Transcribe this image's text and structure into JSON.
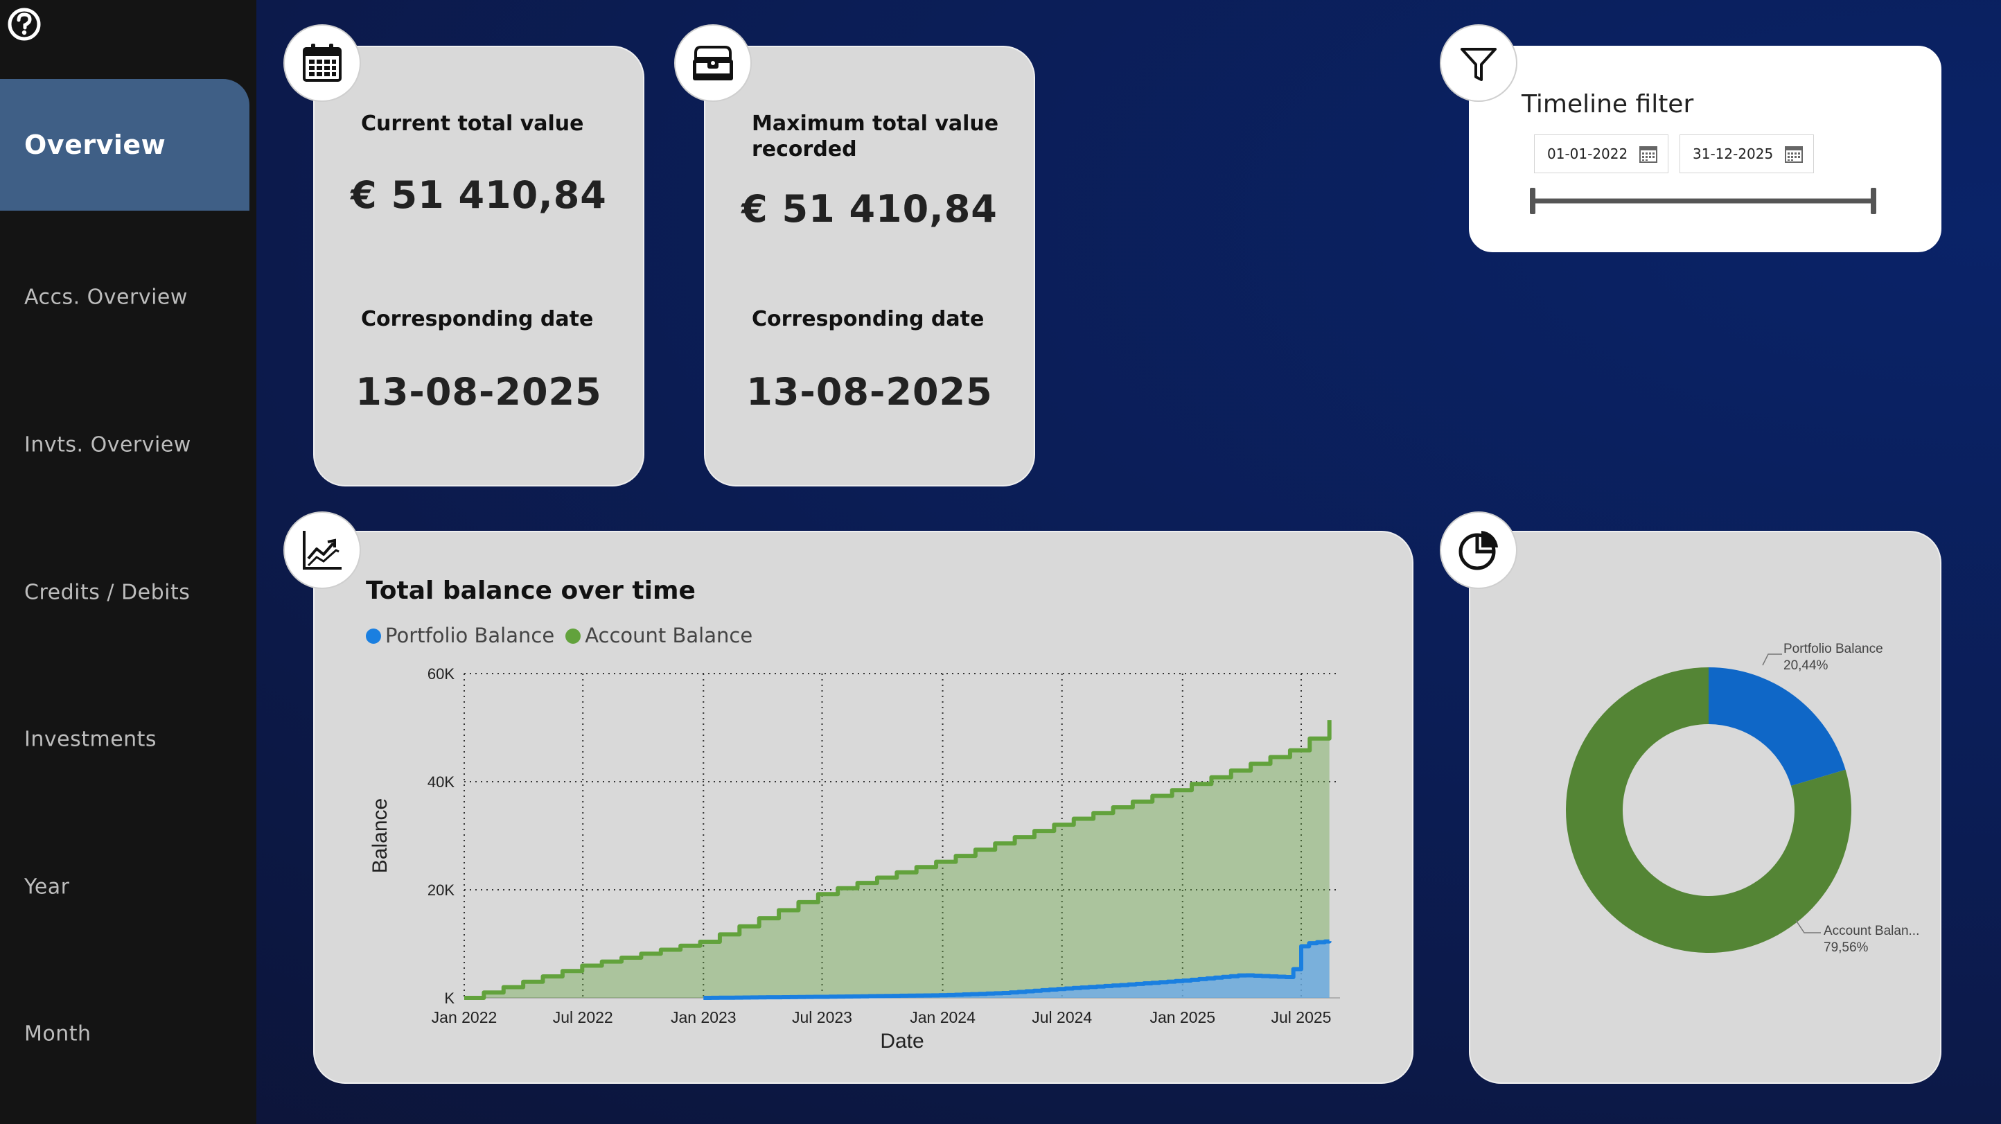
{
  "nav": {
    "items": [
      {
        "label": "Overview",
        "active": true
      },
      {
        "label": "Accs. Overview"
      },
      {
        "label": "Invts. Overview"
      },
      {
        "label": "Credits / Debits"
      },
      {
        "label": "Investments"
      },
      {
        "label": "Year"
      },
      {
        "label": "Month"
      }
    ]
  },
  "kpi_current": {
    "label": "Current total value",
    "value": "€ 51 410,84",
    "date_label": "Corresponding date",
    "date": "13-08-2025",
    "icon": "calendar-icon"
  },
  "kpi_max": {
    "label_line1": "Maximum total value",
    "label_line2": "recorded",
    "value": "€ 51 410,84",
    "date_label": "Corresponding date",
    "date": "13-08-2025",
    "icon": "treasure-chest-icon"
  },
  "filter": {
    "title": "Timeline filter",
    "start": "01-01-2022",
    "end": "31-12-2025",
    "slider_start": 0,
    "slider_end": 1,
    "icon": "funnel-icon"
  },
  "colors": {
    "portfolio": "#1a7fe0",
    "account": "#62a23c",
    "donut_portfolio": "#0f67c7",
    "donut_account": "#548535"
  },
  "chart_data": [
    {
      "type": "area",
      "title": "Total balance over time",
      "xlabel": "Date",
      "ylabel": "Balance",
      "x_ticks": [
        "Jan 2022",
        "Jul 2022",
        "Jan 2023",
        "Jul 2023",
        "Jan 2024",
        "Jul 2024",
        "Jan 2025",
        "Jul 2025"
      ],
      "y_ticks": [
        "K",
        "20K",
        "40K",
        "60K"
      ],
      "ylim": [
        0,
        60000
      ],
      "xlim": [
        "2022-01-01",
        "2025-08-13"
      ],
      "grid": true,
      "legend_position": "top-left",
      "series": [
        {
          "name": "Portfolio Balance",
          "x": [
            "2023-01-01",
            "2023-07-01",
            "2024-01-01",
            "2024-04-01",
            "2024-07-01",
            "2024-10-01",
            "2025-01-01",
            "2025-04-01",
            "2025-06-15",
            "2025-06-30",
            "2025-07-15",
            "2025-08-13"
          ],
          "y": [
            0,
            200,
            500,
            900,
            1700,
            2400,
            3200,
            4200,
            3800,
            9500,
            10200,
            10500
          ]
        },
        {
          "name": "Account Balance",
          "x": [
            "2022-01-01",
            "2022-07-01",
            "2023-01-01",
            "2023-07-01",
            "2024-01-01",
            "2024-07-01",
            "2025-01-01",
            "2025-07-01",
            "2025-08-13"
          ],
          "y": [
            0,
            6000,
            10500,
            19500,
            25500,
            32500,
            39000,
            46500,
            51400
          ]
        }
      ]
    },
    {
      "type": "pie",
      "variant": "donut",
      "labels": [
        "Portfolio Balance",
        "Account Balan..."
      ],
      "values": [
        20.44,
        79.56
      ],
      "value_labels": [
        "20,44%",
        "79,56%"
      ]
    }
  ]
}
